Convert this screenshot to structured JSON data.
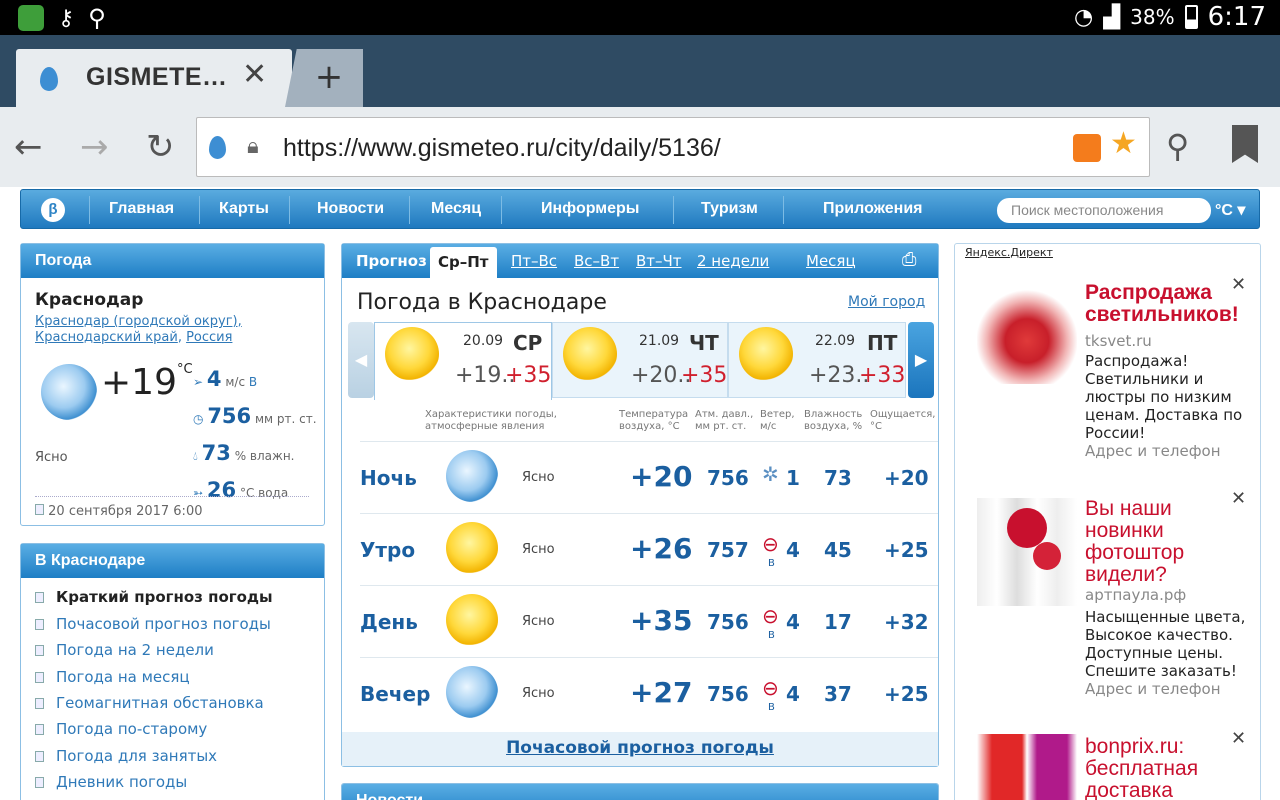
{
  "status": {
    "battery": "38%",
    "time": "6:17"
  },
  "browser": {
    "tab_title": "GISMETE…",
    "url": "https://www.gismeteo.ru/city/daily/5136/"
  },
  "nav": {
    "items": [
      "Главная",
      "Карты",
      "Новости",
      "Месяц",
      "Информеры",
      "Туризм",
      "Приложения"
    ],
    "search_placeholder": "Поиск местоположения",
    "unit": "°C"
  },
  "left": {
    "panel_title": "Погода",
    "city": "Краснодар",
    "region1": "Краснодар (городской округ),",
    "region2": "Краснодарский край",
    "country": "Россия",
    "temp": "+19",
    "temp_unit": "°C",
    "wind_value": "4",
    "wind_unit": "м/с",
    "wind_dir": "В",
    "pressure_value": "756",
    "pressure_unit": "мм рт. ст.",
    "humidity_value": "73",
    "humidity_unit": "% влажн.",
    "water_value": "26",
    "water_unit": "°С вода",
    "condition": "Ясно",
    "updated": "20 сентября 2017 6:00",
    "menu_title": "В Краснодаре",
    "menu": [
      "Краткий прогноз погоды",
      "Почасовой прогноз погоды",
      "Погода на 2 недели",
      "Погода на месяц",
      "Геомагнитная обстановка",
      "Погода по-старому",
      "Погода для занятых",
      "Дневник погоды"
    ]
  },
  "forecast": {
    "tabs": [
      "Прогноз",
      "Ср–Пт",
      "Пт–Вс",
      "Вс–Вт",
      "Вт–Чт",
      "2 недели",
      "Месяц"
    ],
    "title": "Погода в Краснодаре",
    "my_city": "Мой город",
    "days": [
      {
        "date": "20.09",
        "dow": "СР",
        "min": "+19..",
        "max": "+35"
      },
      {
        "date": "21.09",
        "dow": "ЧТ",
        "min": "+20..",
        "max": "+35"
      },
      {
        "date": "22.09",
        "dow": "ПТ",
        "min": "+23..",
        "max": "+33"
      }
    ],
    "headers": {
      "desc": "Характеристики погоды, атмосферные явления",
      "temp": "Температура воздуха, °С",
      "press": "Атм. давл., мм рт. ст.",
      "wind": "Ветер, м/с",
      "hum": "Влажность воздуха, %",
      "feels": "Ощущается, °С"
    },
    "rows": [
      {
        "label": "Ночь",
        "icon": "moon",
        "cond": "Ясно",
        "temp": "+20",
        "press": "756",
        "wind": "1",
        "wdir": "",
        "hum": "73",
        "feels": "+20"
      },
      {
        "label": "Утро",
        "icon": "sun",
        "cond": "Ясно",
        "temp": "+26",
        "press": "757",
        "wind": "4",
        "wdir": "В",
        "hum": "45",
        "feels": "+25"
      },
      {
        "label": "День",
        "icon": "sun",
        "cond": "Ясно",
        "temp": "+35",
        "press": "756",
        "wind": "4",
        "wdir": "В",
        "hum": "17",
        "feels": "+32"
      },
      {
        "label": "Вечер",
        "icon": "moon",
        "cond": "Ясно",
        "temp": "+27",
        "press": "756",
        "wind": "4",
        "wdir": "В",
        "hum": "37",
        "feels": "+25"
      }
    ],
    "hourly_link": "Почасовой прогноз погоды",
    "next_panel": "Новости"
  },
  "ads": {
    "header": "Яндекс.Директ",
    "items": [
      {
        "title": "Распродажа светильников!",
        "site": "tksvet.ru",
        "text": "Распродажа! Светильники и люстры по низким ценам. Доставка по России!",
        "contact": "Адрес и телефон"
      },
      {
        "title": "Вы наши новинки фотоштор видели?",
        "site": "артпаула.рф",
        "text": "Насыщенные цвета, Высокое качество. Доступные цены. Спешите заказать!",
        "contact": "Адрес и телефон"
      },
      {
        "title": "bonprix.ru: бесплатная доставка",
        "site": "",
        "text": "",
        "contact": ""
      }
    ]
  }
}
